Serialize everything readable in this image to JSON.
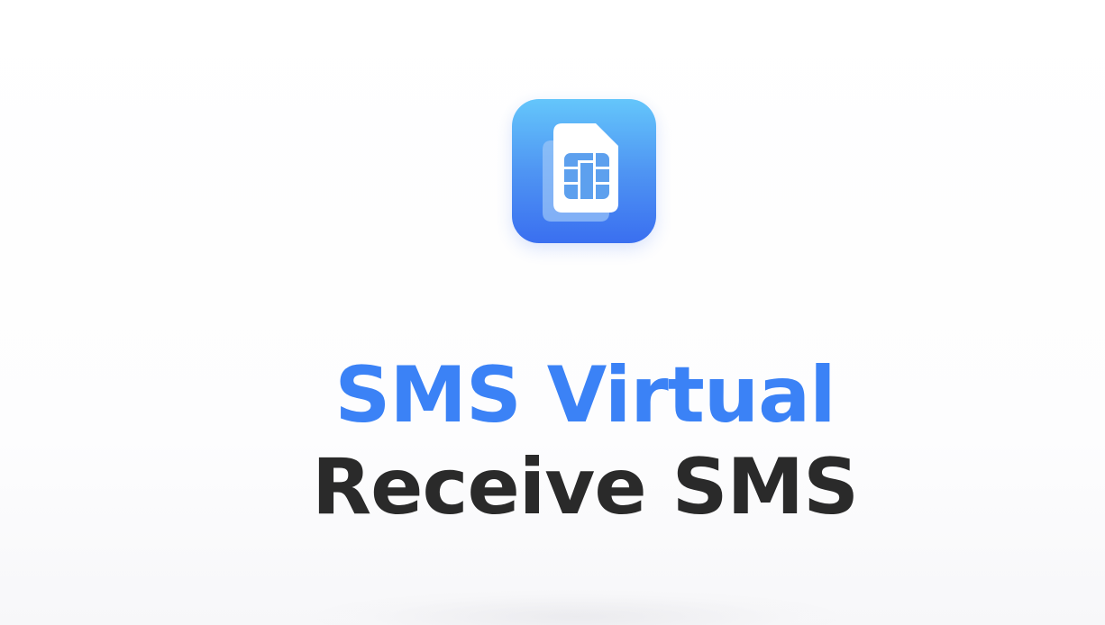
{
  "app": {
    "icon": "sim-card-icon",
    "accent_color": "#3b82f6",
    "icon_gradient_top": "#64c6fb",
    "icon_gradient_bottom": "#3a6ff0"
  },
  "hero": {
    "title_line_1": "SMS Virtual",
    "title_line_2": "Receive SMS",
    "title_line_1_color": "#3b82f6",
    "title_line_2_color": "#2a2a2a"
  }
}
